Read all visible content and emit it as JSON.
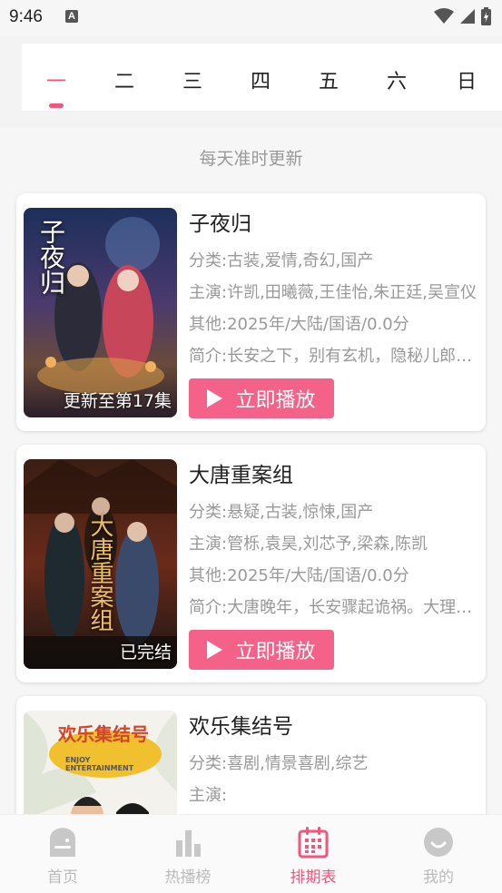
{
  "status_bar": {
    "time": "9:46",
    "notif_icon_letter": "A"
  },
  "day_tabs": [
    {
      "label": "一",
      "active": true
    },
    {
      "label": "二",
      "active": false
    },
    {
      "label": "三",
      "active": false
    },
    {
      "label": "四",
      "active": false
    },
    {
      "label": "五",
      "active": false
    },
    {
      "label": "六",
      "active": false
    },
    {
      "label": "日",
      "active": false
    }
  ],
  "subtitle": "每天准时更新",
  "shows": [
    {
      "title": "子夜归",
      "genre": "分类:古装,爱情,奇幻,国产",
      "cast": "主演:许凯,田曦薇,王佳怡,朱正廷,吴宣仪",
      "other": "其他:2025年/大陆/国语/0.0分",
      "intro": "简介:长安之下，别有玄机，隐秘儿郎，夜夜归来",
      "poster_status": "更新至第17集",
      "poster_text": "子夜归",
      "play_label": "立即播放"
    },
    {
      "title": "大唐重案组",
      "genre": "分类:悬疑,古装,惊悚,国产",
      "cast": "主演:管栎,袁昊,刘芯予,梁森,陈凯",
      "other": "其他:2025年/大陆/国语/0.0分",
      "intro": "简介:大唐晚年，长安骤起诡祸。大理寺众人",
      "poster_status": "已完结",
      "poster_text": "大唐重案组",
      "play_label": "立即播放"
    },
    {
      "title": "欢乐集结号",
      "genre": "分类:喜剧,情景喜剧,综艺",
      "cast": "主演:",
      "poster_text": "欢乐集结号",
      "poster_subtext": "ENJOY ENTERTAINMENT"
    }
  ],
  "bottom_nav": [
    {
      "label": "首页",
      "icon": "home-icon",
      "active": false
    },
    {
      "label": "热播榜",
      "icon": "chart-icon",
      "active": false
    },
    {
      "label": "排期表",
      "icon": "calendar-icon",
      "active": true
    },
    {
      "label": "我的",
      "icon": "profile-icon",
      "active": false
    }
  ],
  "colors": {
    "accent": "#f0577e",
    "button": "#f4628a",
    "muted": "#999999",
    "nav_inactive": "#bbbbbb"
  }
}
